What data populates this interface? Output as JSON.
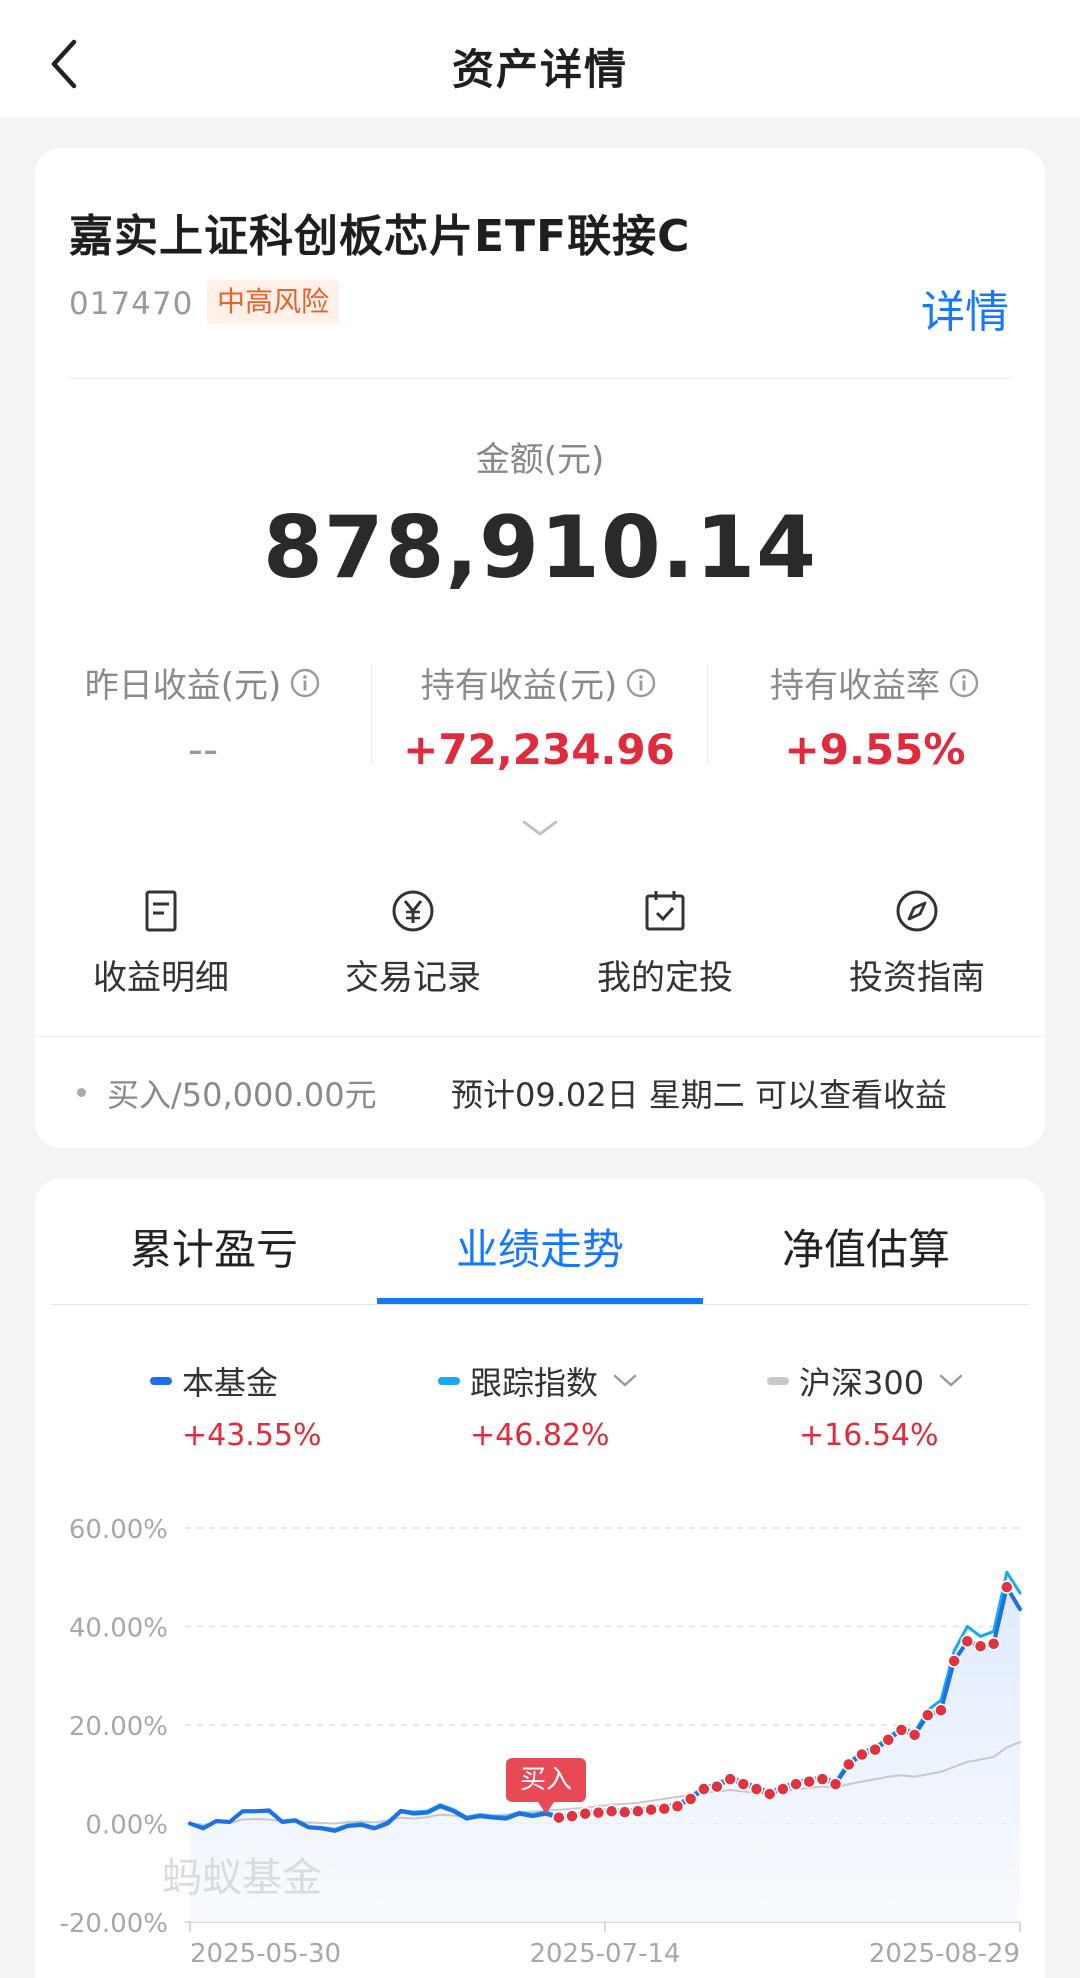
{
  "header": {
    "title": "资产详情"
  },
  "fund": {
    "name": "嘉实上证科创板芯片ETF联接C",
    "code": "017470",
    "risk": "中高风险",
    "detail_link": "详情"
  },
  "amount": {
    "label": "金额(元)",
    "value": "878,910.14"
  },
  "stats": [
    {
      "label": "昨日收益(元)",
      "value": "--"
    },
    {
      "label": "持有收益(元)",
      "value": "+72,234.96"
    },
    {
      "label": "持有收益率",
      "value": "+9.55%"
    }
  ],
  "actions": [
    {
      "label": "收益明细",
      "icon": "document-icon"
    },
    {
      "label": "交易记录",
      "icon": "yen-circle-icon"
    },
    {
      "label": "我的定投",
      "icon": "calendar-check-icon"
    },
    {
      "label": "投资指南",
      "icon": "compass-icon"
    }
  ],
  "pending": {
    "text": "买入/50,000.00元",
    "note": "预计09.02日 星期二 可以查看收益"
  },
  "tabs": [
    {
      "label": "累计盈亏"
    },
    {
      "label": "业绩走势",
      "active": true
    },
    {
      "label": "净值估算"
    }
  ],
  "legend": [
    {
      "name": "本基金",
      "value": "+43.55%",
      "color": "#1f6fe5"
    },
    {
      "name": "跟踪指数",
      "value": "+46.82%",
      "color": "#1aa8f0"
    },
    {
      "name": "沪深300",
      "value": "+16.54%",
      "color": "#c8c8c8"
    }
  ],
  "chart": {
    "watermark": "蚂蚁基金",
    "buy_tag": "买入",
    "x_labels": [
      "2025-05-30",
      "2025-07-14",
      "2025-08-29"
    ]
  },
  "chart_data": {
    "type": "line",
    "ylim": [
      -20,
      60
    ],
    "y_ticks": [
      "60.00%",
      "40.00%",
      "20.00%",
      "0.00%",
      "-20.00%"
    ],
    "x_ticks": [
      "2025-05-30",
      "2025-07-14",
      "2025-08-29"
    ],
    "buy_index": 28,
    "series": [
      {
        "name": "本基金",
        "color": "#1f6fe5",
        "values": [
          0,
          -1,
          0.5,
          0.3,
          2.5,
          2.5,
          2.6,
          0.3,
          0.6,
          -0.8,
          -1,
          -1.5,
          -0.5,
          -0.3,
          -1,
          0,
          2.5,
          2,
          2.2,
          3.5,
          2.5,
          1,
          1.5,
          1.2,
          1,
          2,
          1.5,
          2,
          1.2,
          1.5,
          2,
          2.2,
          2.5,
          2.3,
          2.5,
          2.8,
          3,
          3.5,
          5,
          7,
          7.5,
          9,
          8,
          7,
          6,
          7,
          8,
          8.5,
          9,
          8,
          12,
          14,
          15,
          17,
          19,
          18,
          22,
          23,
          33,
          37,
          36,
          36.5,
          48,
          43.5
        ]
      },
      {
        "name": "跟踪指数",
        "color": "#1aa8f0",
        "values": [
          0.1,
          -0.8,
          0.6,
          0.4,
          2.6,
          2.6,
          2.8,
          0.5,
          0.8,
          -0.6,
          -0.8,
          -1.2,
          -0.3,
          0,
          -0.8,
          0.3,
          2.7,
          2.3,
          2.5,
          3.8,
          2.8,
          1.3,
          1.8,
          1.5,
          1.3,
          2.3,
          1.8,
          2.3,
          1.5,
          1.8,
          2.3,
          2.6,
          2.9,
          2.7,
          2.9,
          3.2,
          3.5,
          4,
          5.5,
          7.5,
          8,
          9.5,
          8.5,
          7.5,
          6.5,
          7.5,
          8.5,
          9,
          9.5,
          8.5,
          12.5,
          14.5,
          15.5,
          17.5,
          19.5,
          18.5,
          23,
          25,
          35,
          40,
          38,
          39,
          51,
          46.8
        ]
      },
      {
        "name": "沪深300",
        "color": "#c8c8c8",
        "values": [
          0,
          -0.3,
          0.2,
          0.1,
          0.8,
          0.9,
          0.8,
          0.4,
          0.5,
          0.2,
          0.1,
          0,
          0.3,
          0.4,
          0.2,
          0.6,
          1.2,
          1,
          1.3,
          1.8,
          1.6,
          1.2,
          1.5,
          1.6,
          1.8,
          2.2,
          2.4,
          2.6,
          2.8,
          3,
          3.2,
          3.5,
          3.8,
          4,
          4.2,
          4.6,
          5,
          5.4,
          5.8,
          6.2,
          6.5,
          6.8,
          6.5,
          6.2,
          6,
          6.5,
          7,
          7.2,
          7.5,
          7.2,
          8,
          8.5,
          9,
          9.5,
          9.8,
          9.5,
          10,
          10.5,
          11.5,
          12.5,
          13,
          13.5,
          15.5,
          16.5
        ]
      }
    ],
    "buy_markers": [
      28,
      29,
      30,
      31,
      32,
      33,
      34,
      35,
      36,
      37,
      38,
      39,
      40,
      41,
      42,
      43,
      44,
      45,
      46,
      47,
      48,
      49,
      50,
      51,
      52,
      53,
      54,
      55,
      56,
      57,
      58,
      59,
      60,
      61,
      62
    ]
  }
}
